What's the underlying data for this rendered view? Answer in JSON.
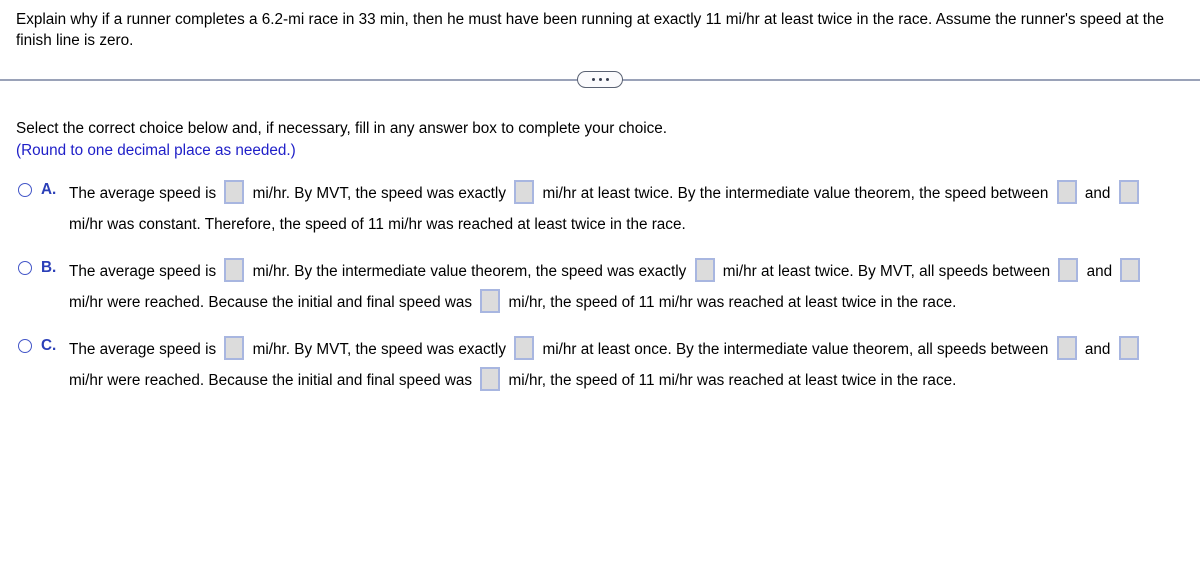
{
  "question": {
    "line1": "Explain why if a runner completes a 6.2-mi race in 33 min, then he must have been running at exactly 11 mi/hr at least twice in the race.",
    "line2": "Assume the runner's speed at the finish line is zero."
  },
  "divider": {
    "dots_label": "..."
  },
  "instructions": {
    "main": "Select the correct choice below and, if necessary, fill in any answer box to complete your choice.",
    "round_note": "(Round to one decimal place as needed.)"
  },
  "choices": [
    {
      "letter": "A.",
      "segments": [
        "The average speed is ",
        "BOX",
        " mi/hr. By MVT, the speed was exactly ",
        "BOX",
        " mi/hr at least twice. By the intermediate value theorem, the speed between ",
        "BOX",
        " and ",
        "BOX",
        " mi/hr was constant. Therefore, the speed of 11 mi/hr was reached at least twice in the race."
      ],
      "text_parts": {
        "p1": "The average speed is ",
        "p2": " mi/hr. By MVT, the speed was exactly ",
        "p3": " mi/hr at least twice. By the intermediate value theorem, the speed between ",
        "p4": " and ",
        "p5": " mi/hr was constant. Therefore, the speed of 11 mi/hr was reached at least twice in the race."
      },
      "box_count": 4
    },
    {
      "letter": "B.",
      "text_parts": {
        "p1": "The average speed is ",
        "p2": " mi/hr. By the intermediate value theorem, the speed was exactly ",
        "p3": " mi/hr at least twice. By MVT, all speeds between ",
        "p4": " and ",
        "p5": " mi/hr were reached. Because the initial and final speed was ",
        "p6": " mi/hr, the speed of 11 mi/hr was reached at least twice in the race."
      },
      "box_count": 5
    },
    {
      "letter": "C.",
      "text_parts": {
        "p1": "The average speed is ",
        "p2": " mi/hr. By MVT, the speed was exactly ",
        "p3": " mi/hr at least once. By the intermediate value theorem, all speeds between ",
        "p4": " and ",
        "p5": " mi/hr were reached. Because the initial and final speed was ",
        "p6": " mi/hr, the speed of 11 mi/hr was reached at least twice in the race."
      },
      "box_count": 5
    }
  ],
  "colors": {
    "choice_letter": "#2b3fb8",
    "radio_border": "#4356c8",
    "round_note": "#2020c8",
    "answer_box_border": "#a8b6e0",
    "answer_box_fill": "#dcdcdc",
    "divider": "#9aa2b8"
  }
}
